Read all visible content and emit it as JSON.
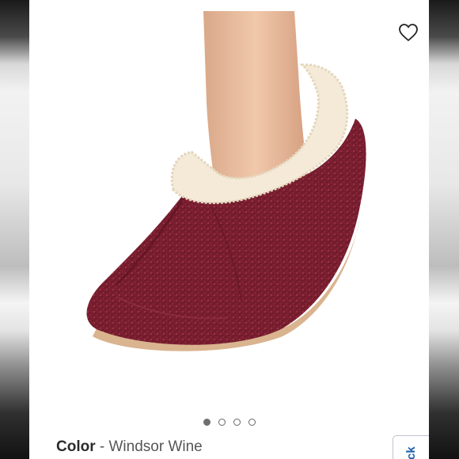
{
  "product": {
    "image_alt": "Windsor Wine knit slipper with sherpa lining",
    "image_count": 4,
    "active_image": 1
  },
  "favorite": {
    "icon": "heart-outline-icon"
  },
  "color": {
    "label": "Color",
    "separator": "-",
    "value": "Windsor Wine"
  },
  "side_tab": {
    "label": "ck"
  },
  "colors": {
    "slipper": "#7a1e30",
    "lining": "#f4ead7",
    "sole": "#d9b48f",
    "tab_text": "#1f5fa8"
  }
}
